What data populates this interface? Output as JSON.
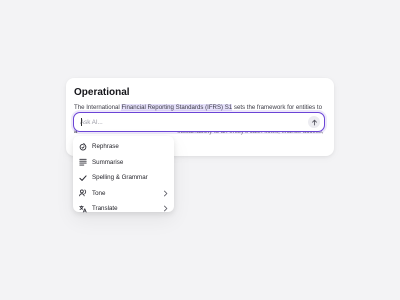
{
  "card": {
    "title": "Operational",
    "line1_before": "The International ",
    "line1_highlight": "Financial Reporting Standards (IFRS) S1",
    "line1_after": " sets the framework for entities to",
    "line2_start": "a",
    "line2_rest": "sustainability to an entity's cash flows, finance access,"
  },
  "ask": {
    "placeholder": "Ask AI...",
    "value": ""
  },
  "menu": {
    "items": [
      {
        "label": "Rephrase",
        "icon": "rephrase-icon",
        "submenu": false
      },
      {
        "label": "Summarise",
        "icon": "summarise-icon",
        "submenu": false
      },
      {
        "label": "Spelling & Grammar",
        "icon": "check-icon",
        "submenu": false
      },
      {
        "label": "Tone",
        "icon": "tone-icon",
        "submenu": true
      },
      {
        "label": "Translate",
        "icon": "translate-icon",
        "submenu": true
      }
    ]
  },
  "colors": {
    "accent": "#6b44d6",
    "highlight": "#e6e1fb",
    "background": "#f3f3f5"
  }
}
